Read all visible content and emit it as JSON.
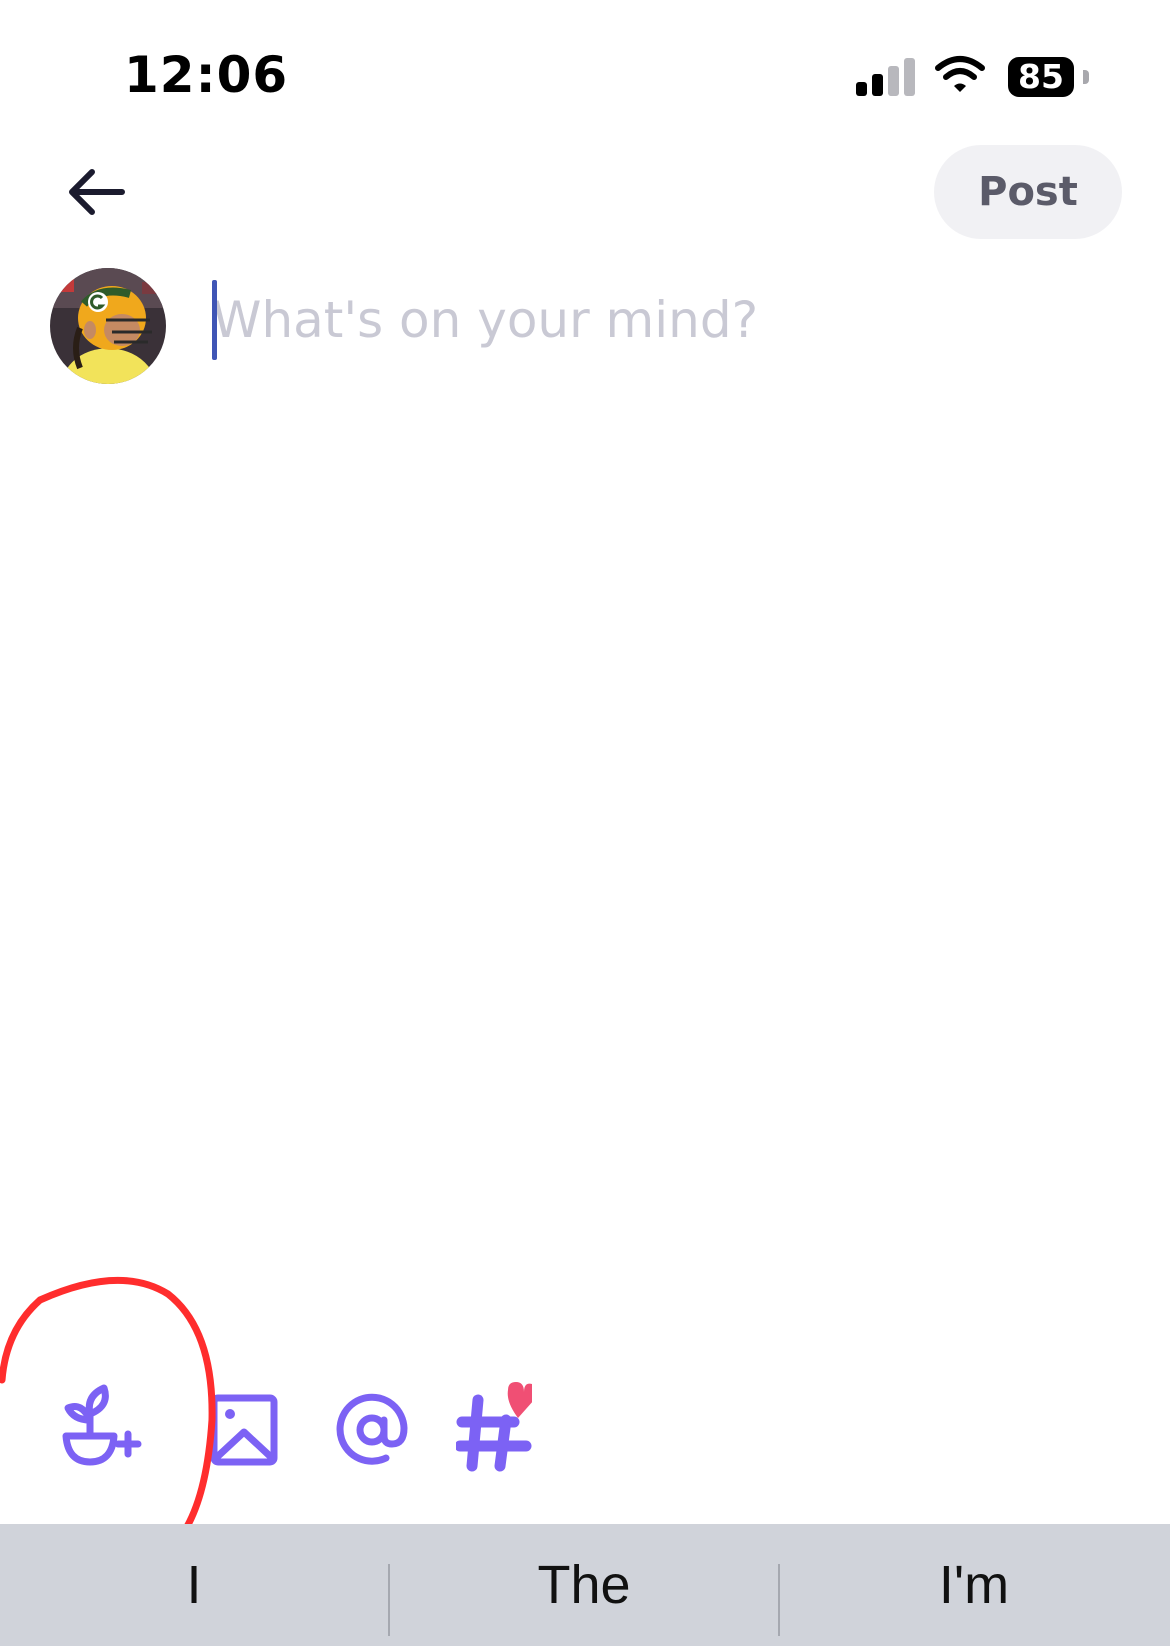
{
  "status_bar": {
    "time": "12:06",
    "battery": "85",
    "signal_icon": "cellular-signal-icon",
    "wifi_icon": "wifi-icon"
  },
  "header": {
    "back_icon": "arrow-left-icon",
    "post_label": "Post"
  },
  "composer": {
    "placeholder": "What's on your mind?",
    "value": ""
  },
  "toolbar": {
    "items": [
      {
        "icon": "plant-plus-icon"
      },
      {
        "icon": "image-icon"
      },
      {
        "icon": "at-sign-icon"
      },
      {
        "icon": "hashtag-heart-icon"
      }
    ]
  },
  "keyboard_suggestions": [
    "I",
    "The",
    "I'm"
  ],
  "colors": {
    "accent": "#7c62f4",
    "hashtag_heart": "#f04f74",
    "post_button_bg": "#f1f1f4",
    "suggestion_bar_bg": "#d0d3da",
    "annotation_circle": "#ff2d2d"
  }
}
